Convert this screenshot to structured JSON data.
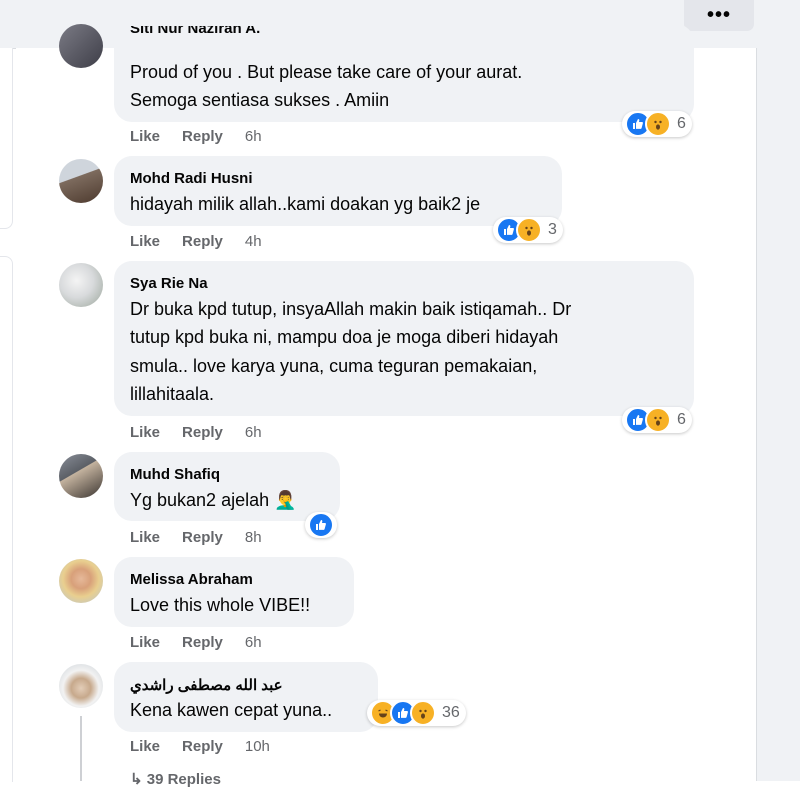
{
  "toolbar": {
    "more_label": "•••"
  },
  "comments": [
    {
      "author": "Siti Nur Nazirah A.",
      "lines": [
        "Proud of you . But please take care of your aurat.",
        "Semoga sentiasa sukses . Amiin"
      ],
      "like": "Like",
      "reply": "Reply",
      "time": "6h",
      "reaction_count": "6"
    },
    {
      "author": "Mohd Radi Husni",
      "lines": [
        "hidayah milik allah..kami doakan yg baik2 je"
      ],
      "like": "Like",
      "reply": "Reply",
      "time": "4h",
      "reaction_count": "3"
    },
    {
      "author": "Sya Rie Na",
      "lines": [
        "Dr buka kpd tutup, insyaAllah makin baik istiqamah.. Dr",
        "tutup kpd buka ni, mampu doa je moga diberi hidayah",
        "smula.. love karya yuna, cuma teguran pemakaian,",
        "lillahitaala."
      ],
      "like": "Like",
      "reply": "Reply",
      "time": "6h",
      "reaction_count": "6"
    },
    {
      "author": "Muhd Shafiq",
      "lines": [
        "Yg bukan2 ajelah 🤦‍♂️"
      ],
      "like": "Like",
      "reply": "Reply",
      "time": "8h",
      "reaction_count": ""
    },
    {
      "author": "Melissa Abraham",
      "lines": [
        "Love this whole VIBE!!"
      ],
      "like": "Like",
      "reply": "Reply",
      "time": "6h",
      "reaction_count": ""
    },
    {
      "author": "عبد الله مصطفى راشدي",
      "lines": [
        "Kena kawen cepat yuna.."
      ],
      "like": "Like",
      "reply": "Reply",
      "time": "10h",
      "reaction_count": "36"
    }
  ],
  "more_replies": "↳ 39 Replies",
  "colors": {
    "like_blue": "#1877f2",
    "bubble_bg": "#f0f2f5",
    "meta_gray": "#65676b"
  }
}
